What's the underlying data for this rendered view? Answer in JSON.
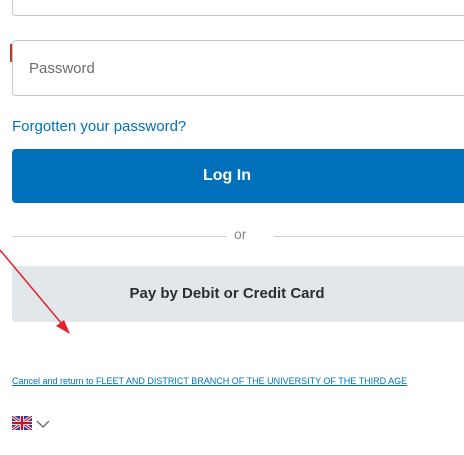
{
  "password": {
    "placeholder": "Password",
    "value": ""
  },
  "forgot_link": "Forgotten your password?",
  "login_button": "Log In",
  "divider_text": "or",
  "card_button": "Pay by Debit or Credit Card",
  "cancel_text": "Cancel and return to FLEET AND DISTRICT BRANCH OF THE UNIVERSITY OF THE THIRD AGE",
  "language": {
    "flag_icon": "uk-flag-icon",
    "chevron_icon": "chevron-down-icon"
  },
  "colors": {
    "primary_blue": "#0070ba",
    "secondary_button": "#e1e7eb",
    "annotation_arrow": "#e8202a"
  }
}
